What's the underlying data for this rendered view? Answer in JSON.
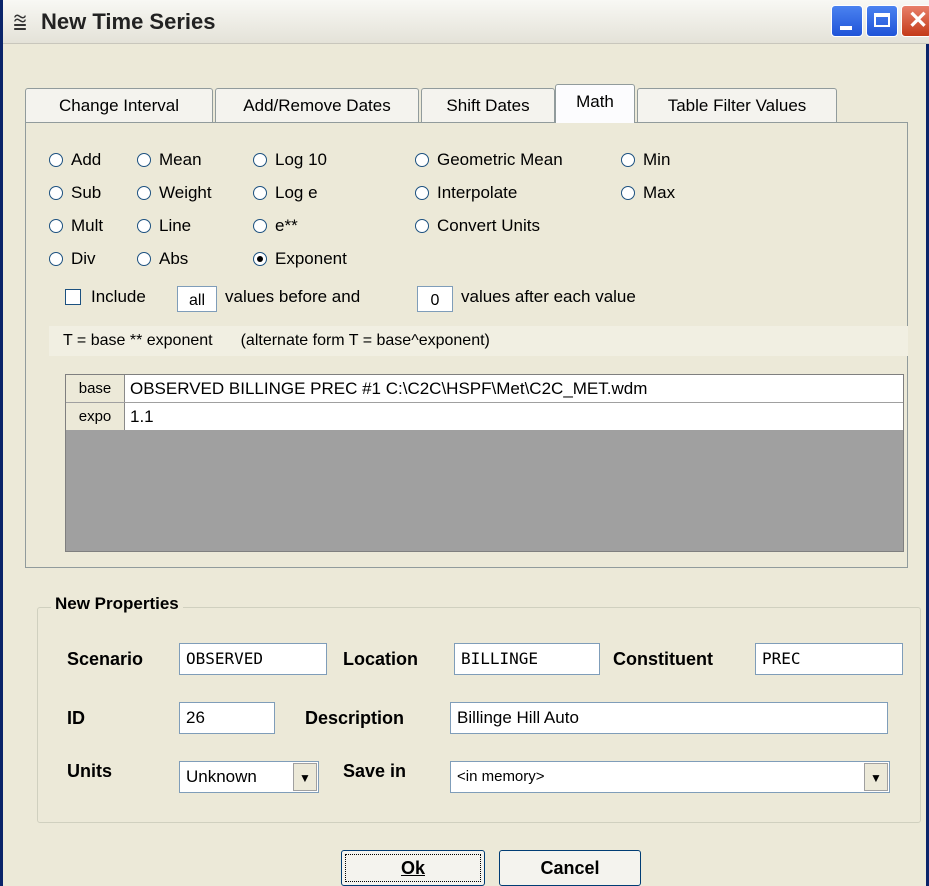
{
  "window": {
    "title": "New Time Series"
  },
  "tabs": [
    {
      "label": "Change Interval"
    },
    {
      "label": "Add/Remove Dates"
    },
    {
      "label": "Shift Dates"
    },
    {
      "label": "Math"
    },
    {
      "label": "Table Filter Values"
    }
  ],
  "math": {
    "operations": {
      "add": "Add",
      "mean": "Mean",
      "log10": "Log 10",
      "geometric_mean": "Geometric Mean",
      "min": "Min",
      "sub": "Sub",
      "weight": "Weight",
      "loge": "Log e",
      "interpolate": "Interpolate",
      "max": "Max",
      "mult": "Mult",
      "line": "Line",
      "epow": "e**",
      "convert_units": "Convert Units",
      "div": "Div",
      "abs": "Abs",
      "exponent": "Exponent"
    },
    "selected": "Exponent",
    "include": {
      "label": "Include",
      "before_value": "all",
      "middle_text": "values before and",
      "after_value": "0",
      "end_text": "values after each value"
    },
    "formula": "T = base ** exponent",
    "formula_alt": "(alternate form T = base^exponent)",
    "args": [
      {
        "name": "base",
        "value": "OBSERVED BILLINGE PREC  #1 C:\\C2C\\HSPF\\Met\\C2C_MET.wdm"
      },
      {
        "name": "expo",
        "value": "1.1"
      }
    ]
  },
  "new_properties": {
    "title": "New Properties",
    "scenario_label": "Scenario",
    "scenario": "OBSERVED",
    "location_label": "Location",
    "location": "BILLINGE",
    "constituent_label": "Constituent",
    "constituent": "PREC",
    "id_label": "ID",
    "id": "26",
    "description_label": "Description",
    "description": "Billinge Hill Auto",
    "units_label": "Units",
    "units": "Unknown",
    "save_in_label": "Save in",
    "save_in": "<in memory>"
  },
  "buttons": {
    "ok": "Ok",
    "cancel": "Cancel"
  }
}
